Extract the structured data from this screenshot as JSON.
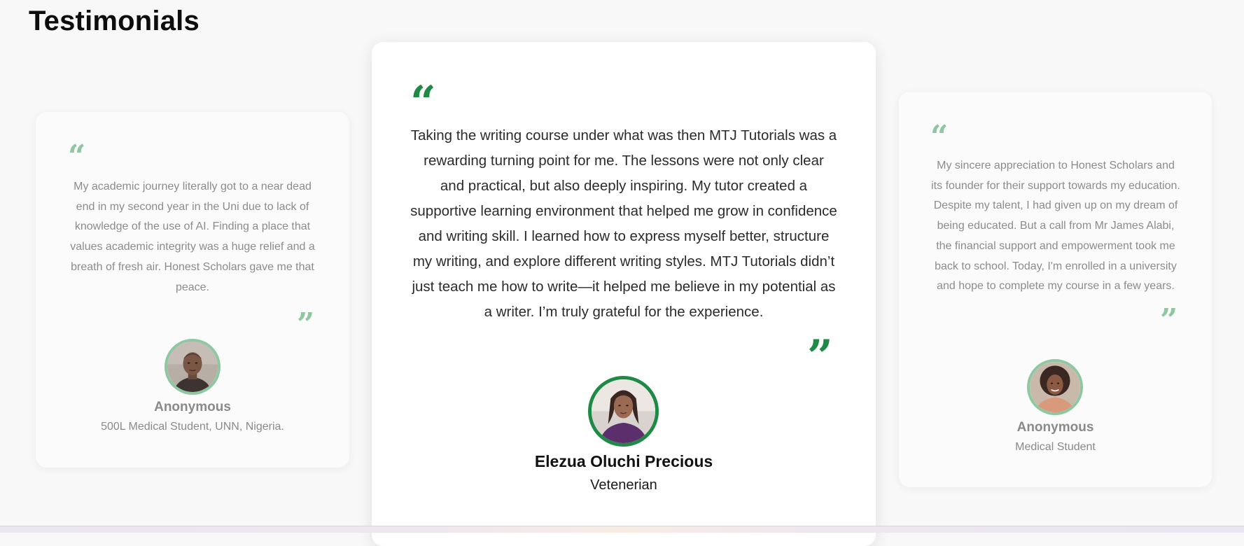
{
  "section": {
    "title": "Testimonials"
  },
  "colors": {
    "accent": "#1e8a46",
    "accent_faded": "#8fc7a1",
    "page_background": "#f8f8f8"
  },
  "testimonials": [
    {
      "quote_open": "“",
      "quote_close": "”",
      "text": "My academic journey literally got to a near dead end in my second year in the Uni due to lack of knowledge of the use of AI. Finding a place that values academic integrity was a huge relief and a breath of fresh air. Honest Scholars gave me that peace.",
      "name": "Anonymous",
      "role": "500L Medical Student, UNN, Nigeria.",
      "avatar_icon": "man-portrait-avatar"
    },
    {
      "quote_open": "“",
      "quote_close": "”",
      "text": "Taking the writing course under what was then MTJ Tutorials was a rewarding turning point for me. The lessons were not only clear and practical, but also deeply inspiring. My tutor created a supportive learning environment that helped me grow in confidence and writing skill. I learned how to express myself better, structure my writing, and explore different writing styles. MTJ Tutorials didn’t just teach me how to write—it helped me believe in my potential as a writer. I’m truly grateful for the experience.",
      "name": "Elezua Oluchi Precious",
      "role": "Veteneriаn",
      "avatar_icon": "woman-portrait-avatar"
    },
    {
      "quote_open": "“",
      "quote_close": "”",
      "text": "My sincere appreciation to Honest Scholars and its founder for their support towards my education. Despite my talent, I had given up on my dream of being educated. But a call from Mr James Alabi, the financial support and empowerment took me back to school. Today, I'm enrolled in a university and hope to complete my course in a few years.",
      "name": "Anonymous",
      "role": "Medical Student",
      "avatar_icon": "woman-portrait-avatar"
    }
  ]
}
